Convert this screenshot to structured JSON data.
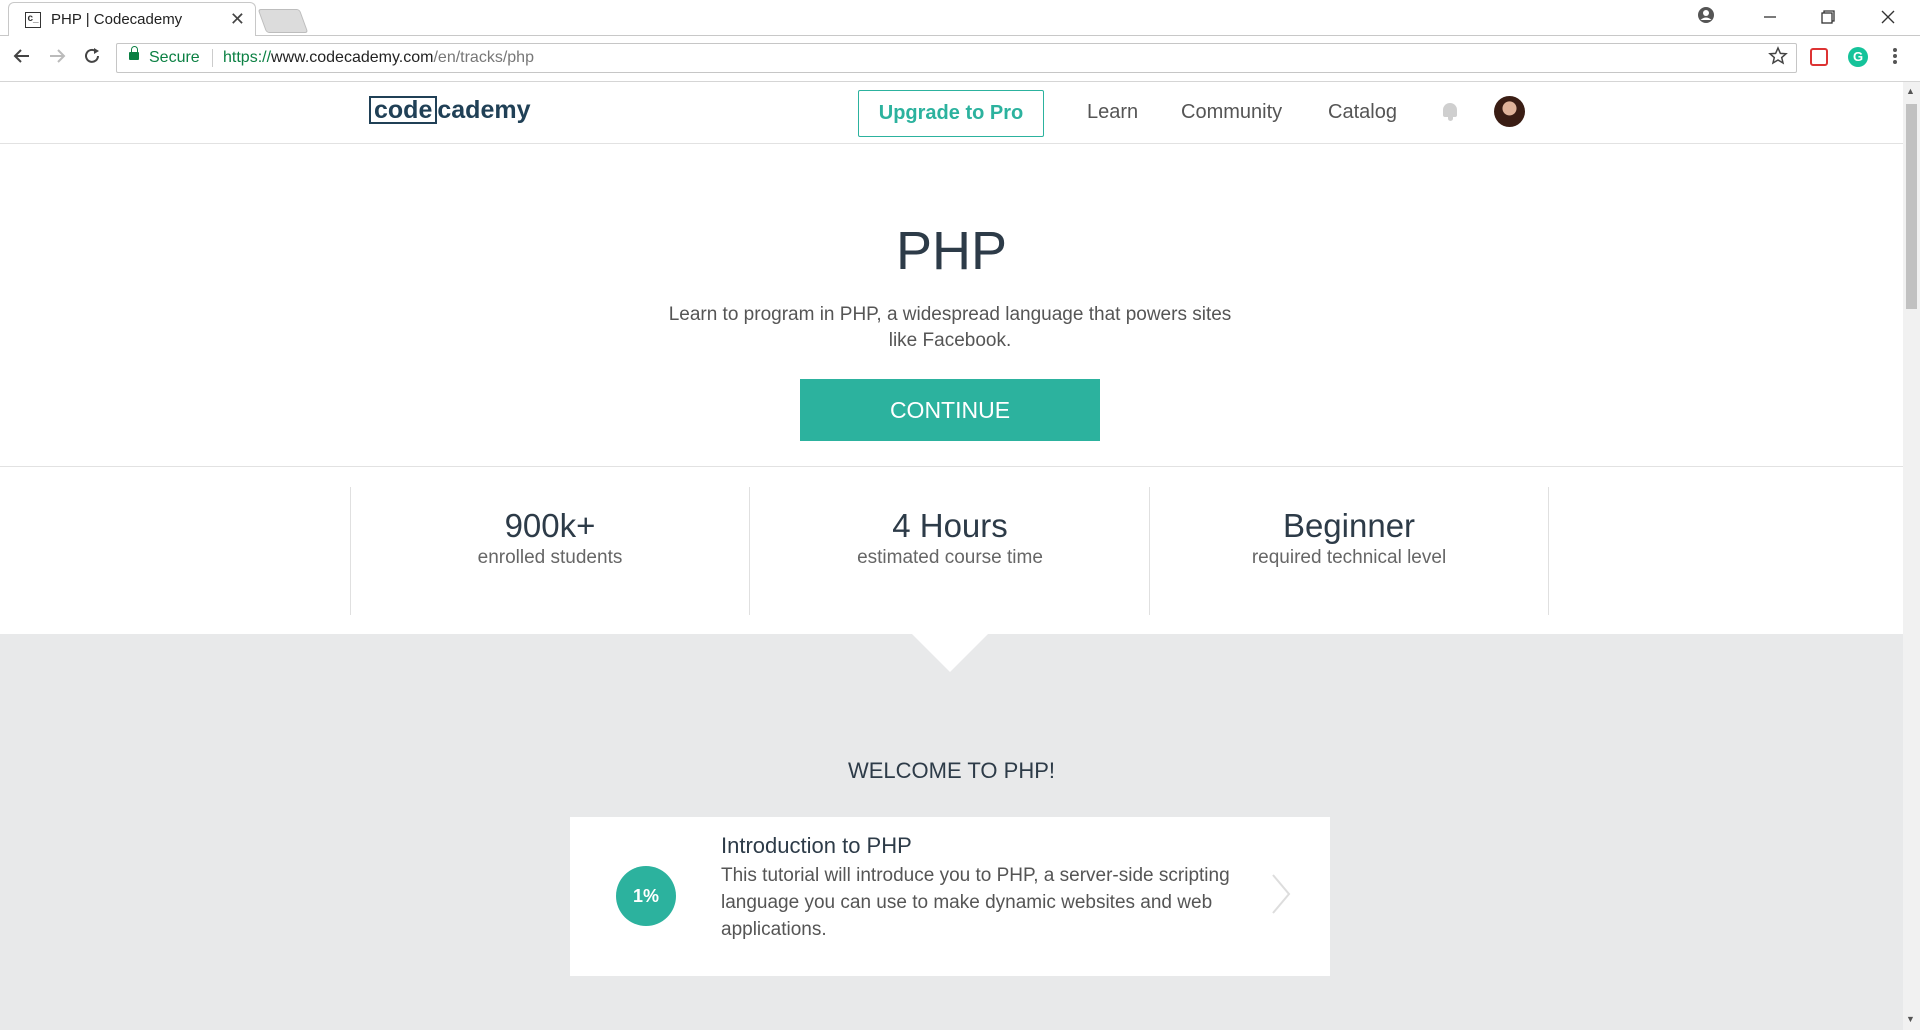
{
  "browser": {
    "tab_title": "PHP | Codecademy",
    "favicon": "c_",
    "close_glyph": "✕",
    "url_https": "https://",
    "url_host": "www.codecademy.com",
    "url_path": "/en/tracks/php",
    "secure_label": "Secure",
    "extension_grammarly": "G"
  },
  "header": {
    "logo_code": "code",
    "logo_cademy": "cademy",
    "upgrade_label": "Upgrade to Pro",
    "nav": [
      "Learn",
      "Community",
      "Catalog"
    ]
  },
  "hero": {
    "title": "PHP",
    "description_line1": "Learn to program in PHP, a widespread language that powers sites",
    "description_line2": "like Facebook.",
    "continue_label": "CONTINUE"
  },
  "stats": [
    {
      "value": "900k+",
      "label": "enrolled students"
    },
    {
      "value": "4 Hours",
      "label": "estimated course time"
    },
    {
      "value": "Beginner",
      "label": "required technical level"
    }
  ],
  "welcome": {
    "heading": "WELCOME TO PHP!",
    "course": {
      "progress": "1%",
      "title": "Introduction to PHP",
      "description": "This tutorial will introduce you to PHP, a server-side scripting language you can use to make dynamic websites and web applications."
    }
  },
  "colors": {
    "accent": "#2cb29e",
    "brand_navy": "#204056",
    "gray_section": "#e8e9ea"
  }
}
